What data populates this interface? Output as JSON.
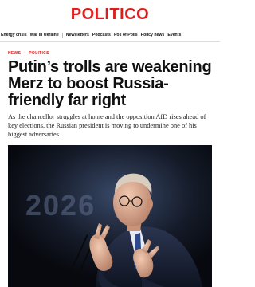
{
  "site": {
    "logo": "POLITICO",
    "brand_color": "#dc1e1e"
  },
  "nav": {
    "items": [
      {
        "label": "Energy crisis"
      },
      {
        "label": "War in Ukraine"
      },
      {
        "label": "Newsletters"
      },
      {
        "label": "Podcasts"
      },
      {
        "label": "Poll of Polls"
      },
      {
        "label": "Policy news"
      },
      {
        "label": "Events"
      }
    ]
  },
  "article": {
    "kicker": [
      "NEWS",
      "POLITICS"
    ],
    "headline": "Putin’s trolls are weakening Merz to boost Russia-friendly far right",
    "dek": "As the chancellor struggles at home and the opposition AfD rises ahead of key elections, the Russian president is moving to undermine one of his biggest adversaries.",
    "image": {
      "backdrop_text": "2026"
    }
  }
}
